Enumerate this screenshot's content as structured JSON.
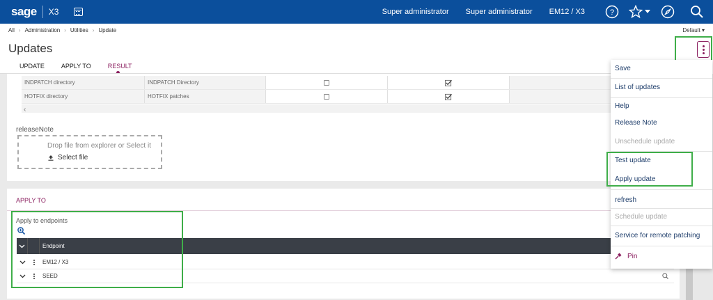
{
  "topbar": {
    "logo": "sage",
    "product": "X3",
    "user1": "Super administrator",
    "user2": "Super administrator",
    "endpoint": "EM12 / X3"
  },
  "breadcrumb": [
    "All",
    "Administration",
    "Utilities",
    "Update"
  ],
  "default_selector": "Default",
  "page_title": "Updates",
  "tabs": [
    {
      "label": "UPDATE"
    },
    {
      "label": "APPLY TO"
    },
    {
      "label": "RESULT",
      "active": true
    }
  ],
  "grid_rows": [
    {
      "col1": "INDPATCH directory",
      "col2": "INDPATCH Directory",
      "checked1": false,
      "checked2": true
    },
    {
      "col1": "HOTFIX directory",
      "col2": "HOTFIX patches",
      "checked1": false,
      "checked2": true
    }
  ],
  "release_note": {
    "label": "releaseNote",
    "drop_text": "Drop file from explorer or Select it",
    "select_file": "Select file"
  },
  "apply_to": {
    "title": "APPLY TO",
    "endpoints_label": "Apply to endpoints",
    "column_header": "Endpoint",
    "rows": [
      "EM12 / X3",
      "SEED"
    ]
  },
  "menu": {
    "items": [
      {
        "label": "Save",
        "disabled": false
      },
      {
        "label": "List of updates",
        "disabled": false
      },
      {
        "label": "Help",
        "disabled": false
      },
      {
        "label": "Release Note",
        "disabled": false
      },
      {
        "label": "Unschedule update",
        "disabled": true
      },
      {
        "label": "Test update",
        "disabled": false
      },
      {
        "label": "Apply update",
        "disabled": false
      },
      {
        "label": "refresh",
        "disabled": false
      },
      {
        "label": "Schedule update",
        "disabled": true
      },
      {
        "label": "Service for remote patching",
        "disabled": false
      },
      {
        "label": "Pin",
        "disabled": false
      }
    ]
  },
  "colors": {
    "topbar": "#0b4f9c",
    "accent": "#8b1f5f",
    "highlight": "#3fae49",
    "menu_text": "#1f3e6b"
  }
}
